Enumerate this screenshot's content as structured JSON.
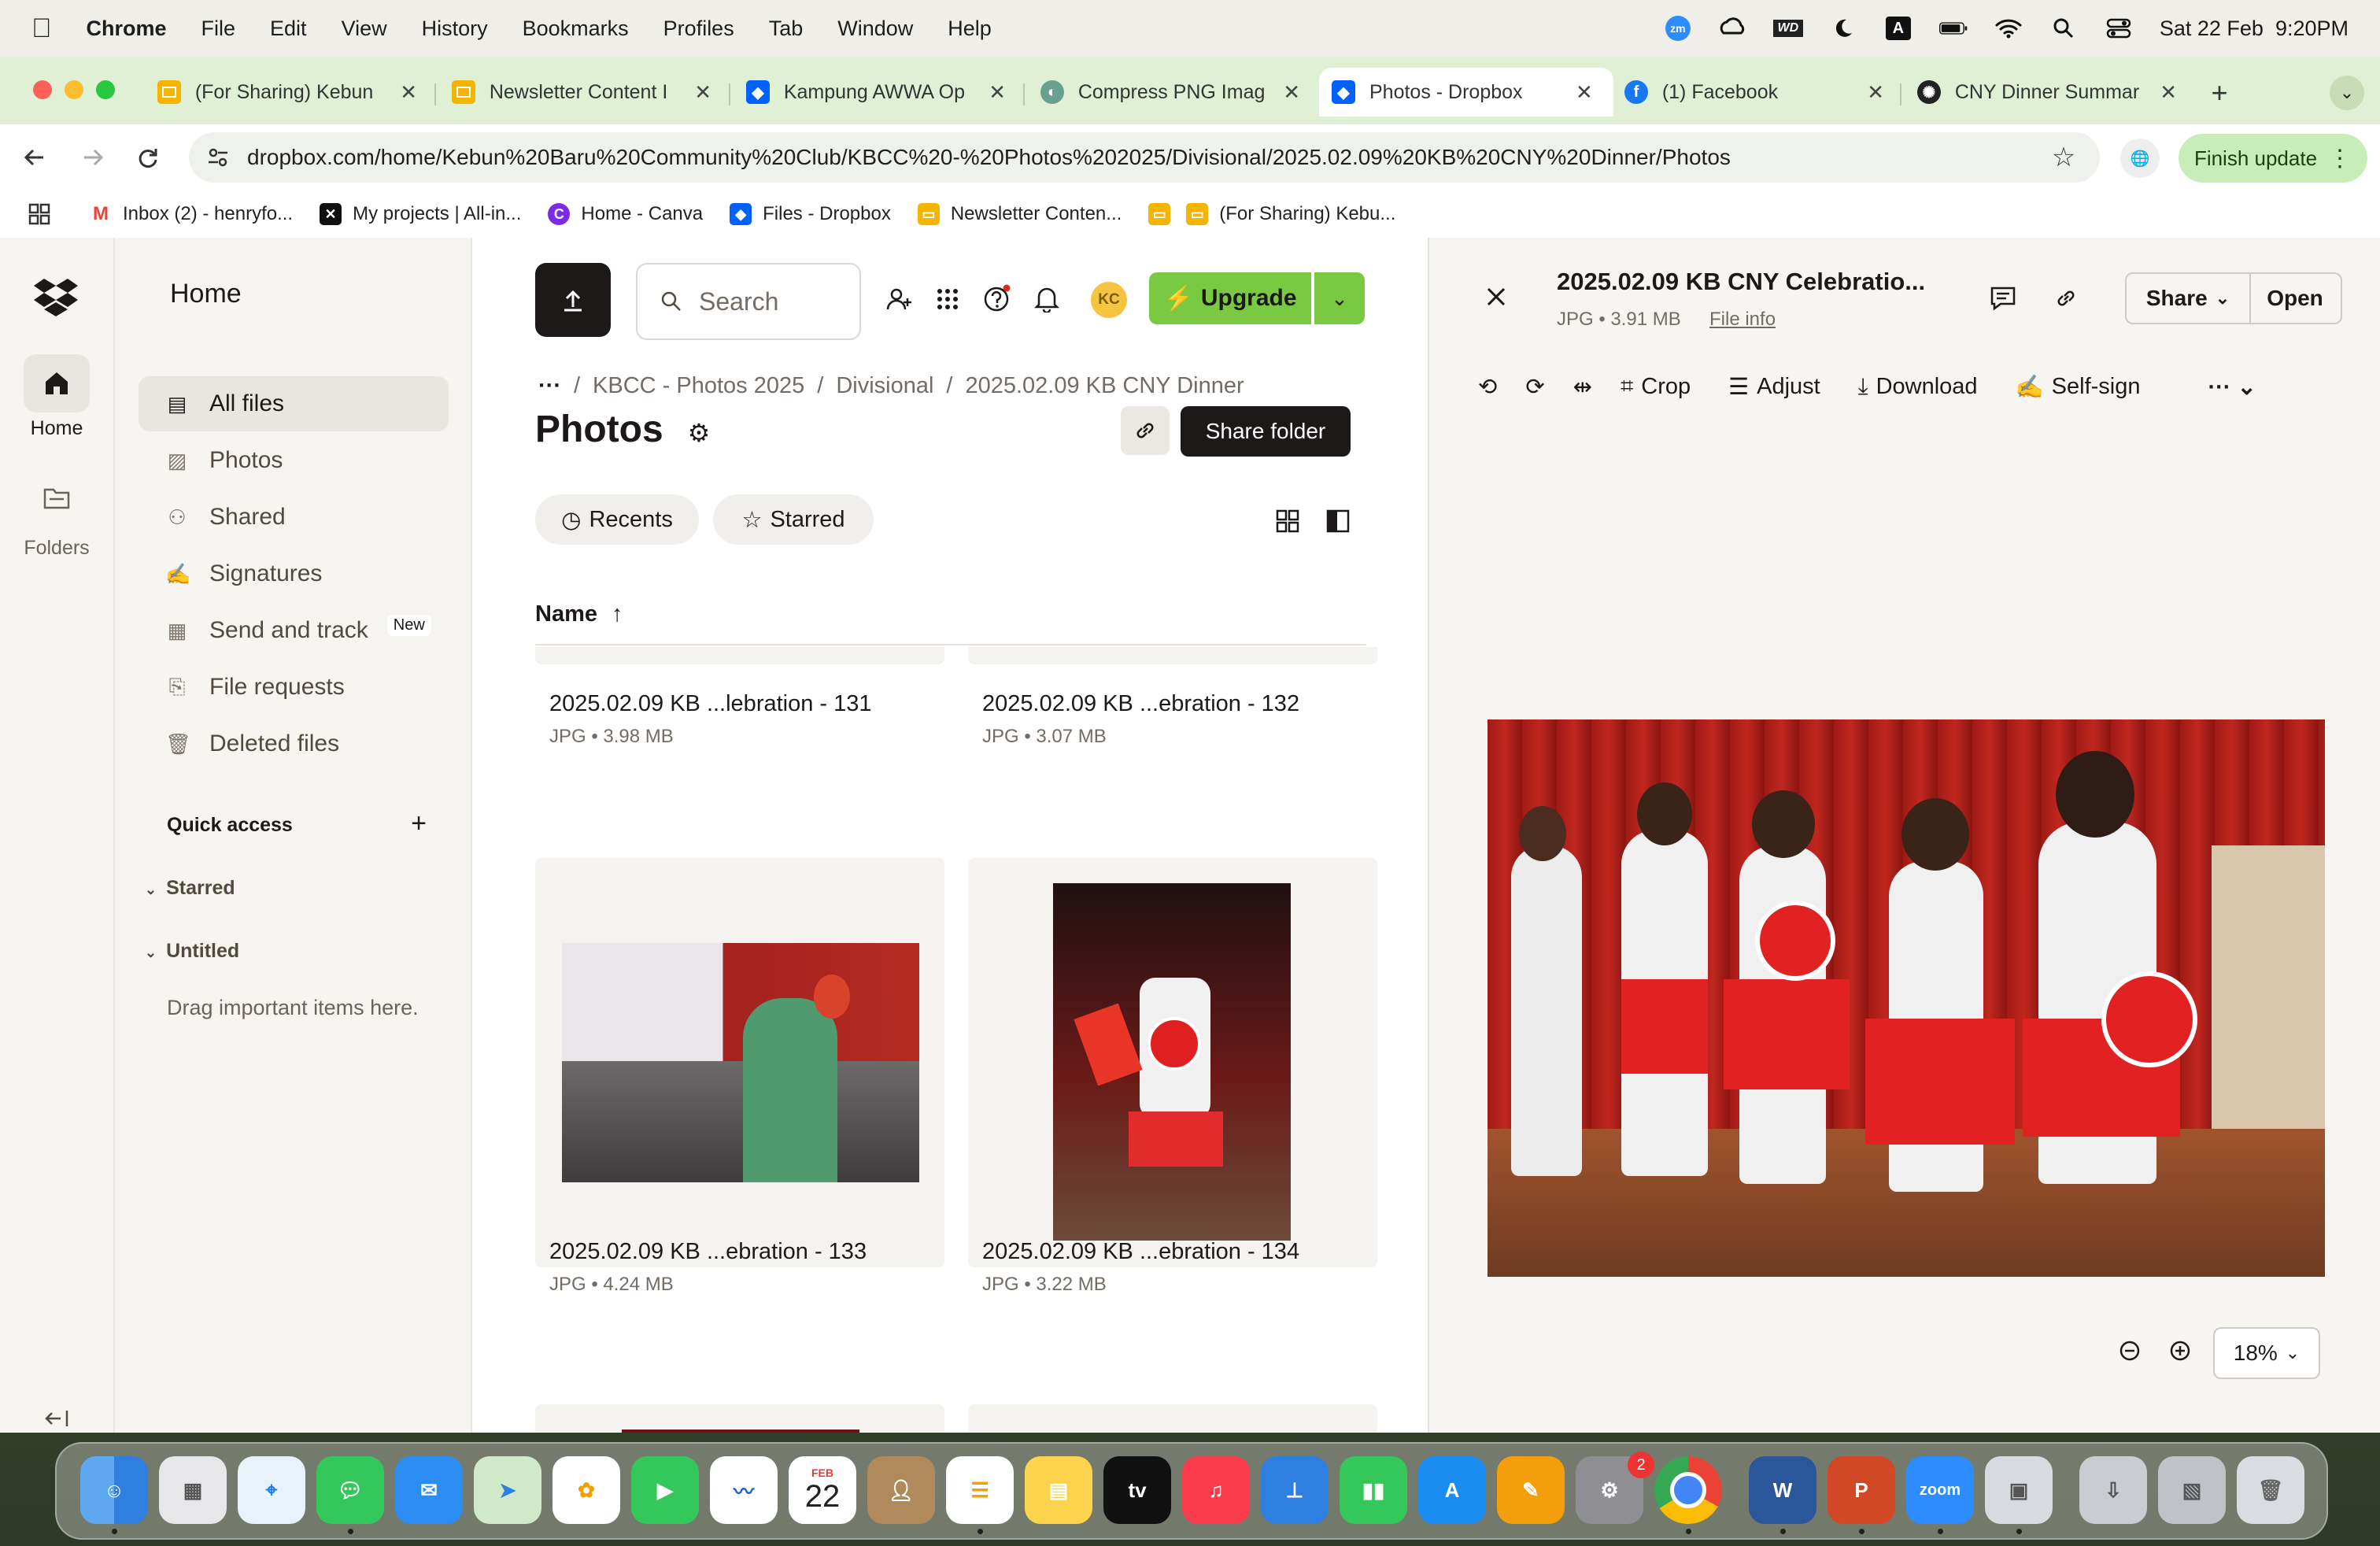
{
  "menubar": {
    "app_name": "Chrome",
    "items": [
      "File",
      "Edit",
      "View",
      "History",
      "Bookmarks",
      "Profiles",
      "Tab",
      "Window",
      "Help"
    ],
    "datetime": "Sat 22 Feb  9:20PM",
    "status_icons": [
      "zoom-icon",
      "creative-cloud-icon",
      "wd-icon",
      "moon-icon",
      "input-source-icon",
      "battery-icon",
      "wifi-icon",
      "spotlight-search-icon",
      "control-center-icon"
    ]
  },
  "tabs": [
    {
      "title": "(For Sharing) Kebun",
      "icon": "google-slides-icon",
      "color": "#f4b400"
    },
    {
      "title": "Newsletter Content I",
      "icon": "google-slides-icon",
      "color": "#f4b400"
    },
    {
      "title": "Kampung AWWA Op",
      "icon": "dropbox-icon",
      "color": "#0061fe"
    },
    {
      "title": "Compress PNG Imag",
      "icon": "tinypng-icon",
      "color": "#6aa08f"
    },
    {
      "title": "Photos - Dropbox",
      "icon": "dropbox-icon",
      "color": "#0061fe",
      "active": true
    },
    {
      "title": "(1) Facebook",
      "icon": "facebook-icon",
      "color": "#1877f2"
    },
    {
      "title": "CNY Dinner Summar",
      "icon": "chatgpt-icon",
      "color": "#222222"
    }
  ],
  "toolbar": {
    "url": "dropbox.com/home/Kebun%20Baru%20Community%20Club/KBCC%20-%20Photos%202025/Divisional/2025.02.09%20KB%20CNY%20Dinner/Photos",
    "finish_update": "Finish update"
  },
  "bookmarks": [
    {
      "label": "Inbox (2) - henryfo...",
      "icon": "gmail-icon",
      "color": "#ea4335"
    },
    {
      "label": "My projects | All-in...",
      "icon": "capcut-icon",
      "color": "#111111"
    },
    {
      "label": "Home - Canva",
      "icon": "canva-icon",
      "color": "#7d2ae8"
    },
    {
      "label": "Files - Dropbox",
      "icon": "dropbox-icon",
      "color": "#0061fe"
    },
    {
      "label": "Newsletter Conten...",
      "icon": "google-slides-icon",
      "color": "#f4b400"
    },
    {
      "label": "",
      "icon": "google-slides-icon",
      "color": "#f4b400"
    },
    {
      "label": "(For Sharing) Kebu...",
      "icon": "google-slides-icon",
      "color": "#f4b400"
    }
  ],
  "rail": {
    "home": "Home",
    "folders": "Folders"
  },
  "sidebar": {
    "title": "Home",
    "items": [
      {
        "label": "All files",
        "icon": "all-files-icon",
        "selected": true
      },
      {
        "label": "Photos",
        "icon": "photos-icon"
      },
      {
        "label": "Shared",
        "icon": "shared-icon"
      },
      {
        "label": "Signatures",
        "icon": "signature-icon"
      },
      {
        "label": "Send and track",
        "icon": "send-track-icon",
        "badge": "New"
      },
      {
        "label": "File requests",
        "icon": "file-request-icon"
      },
      {
        "label": "Deleted files",
        "icon": "trash-icon"
      }
    ],
    "quick_access": "Quick access",
    "starred": "Starred",
    "untitled": "Untitled",
    "drag_hint": "Drag important items here."
  },
  "main": {
    "search_placeholder": "Search",
    "avatar_initials": "KC",
    "upgrade": "Upgrade",
    "breadcrumb": [
      "KBCC - Photos 2025",
      "Divisional",
      "2025.02.09 KB CNY Dinner"
    ],
    "title": "Photos",
    "share_folder": "Share folder",
    "filters": [
      "Recents",
      "Starred"
    ],
    "column_name": "Name",
    "files": [
      {
        "name": "2025.02.09 KB ...lebration - 131",
        "meta": "JPG • 3.98 MB"
      },
      {
        "name": "2025.02.09 KB ...ebration - 132",
        "meta": "JPG • 3.07 MB"
      },
      {
        "name": "2025.02.09 KB ...ebration - 133",
        "meta": "JPG • 4.24 MB"
      },
      {
        "name": "2025.02.09 KB ...ebration - 134",
        "meta": "JPG • 3.22 MB"
      }
    ]
  },
  "preview": {
    "title": "2025.02.09 KB CNY Celebratio...",
    "meta": "JPG • 3.91 MB",
    "file_info": "File info",
    "share": "Share",
    "open": "Open",
    "tools": [
      "Crop",
      "Adjust",
      "Download",
      "Self-sign"
    ],
    "zoom": "18%"
  },
  "dock": {
    "calendar_month": "FEB",
    "calendar_day": "22",
    "settings_badge": "2",
    "zoom_label": "zoom",
    "apps": [
      "finder",
      "launchpad",
      "safari",
      "messages",
      "mail",
      "maps",
      "photos",
      "facetime",
      "freeform",
      "calendar",
      "contacts",
      "reminders",
      "notes",
      "apple-tv",
      "music",
      "keynote",
      "numbers",
      "app-store",
      "pages",
      "system-settings",
      "chrome",
      "word",
      "powerpoint",
      "zoom",
      "preview",
      "downloads",
      "screenshots",
      "trash"
    ]
  }
}
